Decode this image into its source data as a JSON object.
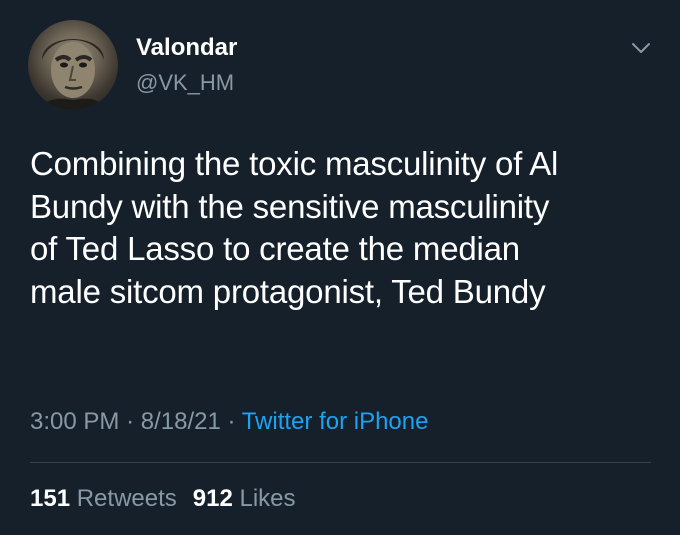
{
  "author": {
    "display_name": "Valondar",
    "handle": "@VK_HM",
    "avatar_icon": "user-avatar-photo"
  },
  "tweet": {
    "text_lines": [
      "Combining the toxic masculinity of Al",
      "Bundy with the sensitive masculinity",
      "of Ted Lasso to create the median",
      "male sitcom protagonist, Ted Bundy"
    ],
    "time": "3:00 PM",
    "separator": "·",
    "date": "8/18/21",
    "source": "Twitter for iPhone"
  },
  "stats": {
    "retweets_count": "151",
    "retweets_label": "Retweets",
    "likes_count": "912",
    "likes_label": "Likes"
  },
  "colors": {
    "background": "#15202b",
    "primary_text": "#ffffff",
    "secondary_text": "#8899a6",
    "link": "#1da1f2",
    "divider": "#38444d"
  },
  "icons": {
    "menu": "chevron-down-icon"
  }
}
